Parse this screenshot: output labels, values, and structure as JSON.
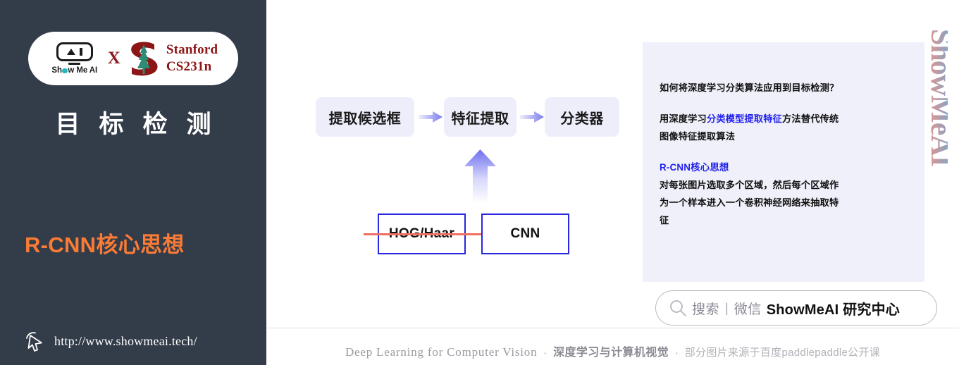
{
  "sidebar": {
    "logo": {
      "showmeai_wordmark_pre": "Sh",
      "showmeai_wordmark_post": "w Me AI",
      "cross_symbol": "X",
      "stanford_line1": "Stanford",
      "stanford_line2": "CS231n"
    },
    "topic_title": "目标检测",
    "sub_title": "R-CNN核心思想",
    "site_url": "http://www.showmeai.tech/"
  },
  "diagram": {
    "boxes": [
      {
        "label": "提取候选框"
      },
      {
        "label": "特征提取"
      },
      {
        "label": "分类器"
      }
    ],
    "method_boxes": [
      {
        "label": "HOG/Haar",
        "struck_out": true
      },
      {
        "label": "CNN",
        "struck_out": false
      }
    ]
  },
  "panel": {
    "question": "如何将深度学习分类算法应用到目标检测？",
    "statement_part1": "用深度学习",
    "statement_highlight": "分类模型提取特征",
    "statement_part2": "方法替代传统",
    "statement_line2": "图像特征提取算法",
    "section_heading": "R-CNN核心思想",
    "section_line1": "对每张图片选取多个区域，然后每个区域作",
    "section_line2": "为一个样本进入一个卷积神经网络来抽取特",
    "section_line3": "征"
  },
  "search": {
    "label": "搜索",
    "divider": "|",
    "channel": "微信",
    "brand": "ShowMeAI 研究中心"
  },
  "watermark": {
    "text": "ShowMeAI"
  },
  "footer": {
    "english": "Deep Learning for Computer Vision",
    "dot1": "·",
    "chinese_bold": "深度学习与计算机视觉",
    "dot2": "·",
    "credit": "部分图片来源于百度paddlepaddle公开课"
  },
  "colors": {
    "sidebar_bg": "#333c49",
    "accent_orange": "#f97b36",
    "accent_blue": "#2222ee",
    "box_lavender": "#eeeefb",
    "panel_bg": "#f0f0fa",
    "border_blue": "#2727e0",
    "strike_red": "#ef6f61",
    "stanford_red": "#8c1515",
    "tree_green": "#2e8b74"
  }
}
